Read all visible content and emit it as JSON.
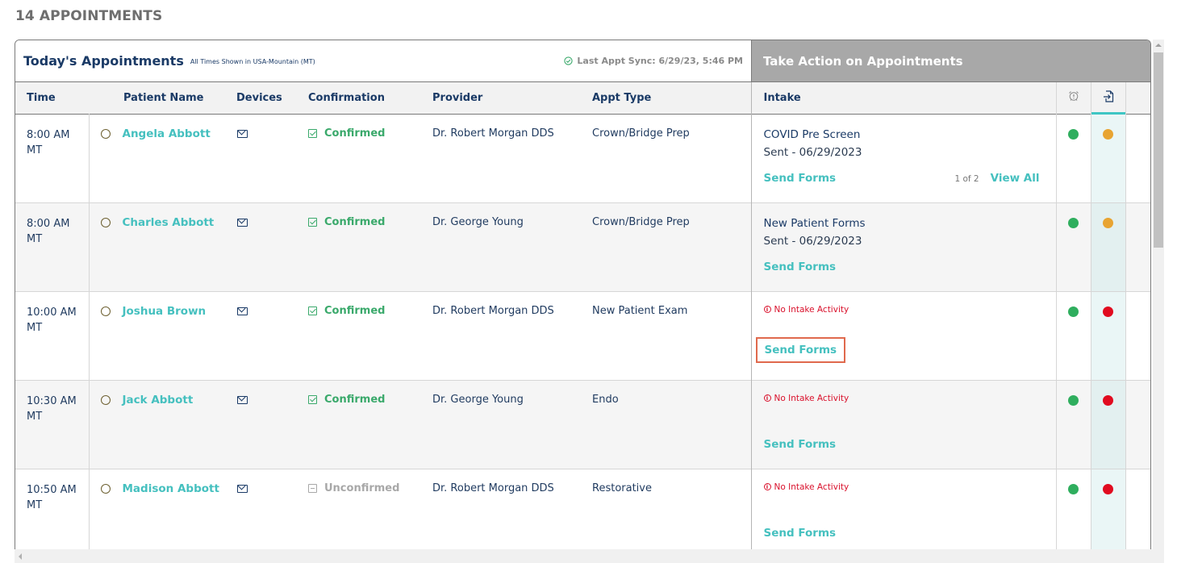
{
  "page": {
    "heading": "14 APPOINTMENTS"
  },
  "panel": {
    "title": "Today's Appointments",
    "timezone_note": "All Times Shown in USA-Mountain (MT)",
    "sync_text": "Last Appt Sync: 6/29/23, 5:46 PM",
    "action_title": "Take Action on Appointments"
  },
  "columns": {
    "time": "Time",
    "patient_name": "Patient Name",
    "devices": "Devices",
    "confirmation": "Confirmation",
    "provider": "Provider",
    "appt_type": "Appt Type",
    "intake": "Intake",
    "reminder_icon": "alarm-clock-icon",
    "forms_icon": "form-import-icon"
  },
  "actions": {
    "send_forms": "Send Forms",
    "view_all": "View All"
  },
  "colors": {
    "accent_teal": "#45c0bf",
    "confirmed_green": "#3aa96b",
    "status_green": "#2fae5e",
    "status_orange": "#e8a432",
    "status_red": "#e10b1f",
    "header_gray": "#a8a8a8"
  },
  "rows": [
    {
      "time": "8:00 AM",
      "tz": "MT",
      "patient": "Angela Abbott",
      "device": "email",
      "confirmation": "Confirmed",
      "provider": "Dr. Robert Morgan DDS",
      "appt_type": "Crown/Bridge Prep",
      "intake_title": "COVID Pre Screen",
      "intake_sent": "Sent - 06/29/2023",
      "pager": "1 of 2",
      "reminder_status": "green",
      "forms_status": "orange"
    },
    {
      "time": "8:00 AM",
      "tz": "MT",
      "patient": "Charles Abbott",
      "device": "email",
      "confirmation": "Confirmed",
      "provider": "Dr. George Young",
      "appt_type": "Crown/Bridge Prep",
      "intake_title": "New Patient Forms",
      "intake_sent": "Sent - 06/29/2023",
      "reminder_status": "green",
      "forms_status": "orange"
    },
    {
      "time": "10:00 AM",
      "tz": "MT",
      "patient": "Joshua Brown",
      "device": "email",
      "confirmation": "Confirmed",
      "provider": "Dr. Robert Morgan DDS",
      "appt_type": "New Patient Exam",
      "intake_alert": "No Intake Activity",
      "reminder_status": "green",
      "forms_status": "red",
      "highlighted": true
    },
    {
      "time": "10:30 AM",
      "tz": "MT",
      "patient": "Jack Abbott",
      "device": "email",
      "confirmation": "Confirmed",
      "provider": "Dr. George Young",
      "appt_type": "Endo",
      "intake_alert": "No Intake Activity",
      "reminder_status": "green",
      "forms_status": "red"
    },
    {
      "time": "10:50 AM",
      "tz": "MT",
      "patient": "Madison Abbott",
      "device": "email",
      "confirmation": "Unconfirmed",
      "provider": "Dr. Robert Morgan DDS",
      "appt_type": "Restorative",
      "intake_alert": "No Intake Activity",
      "reminder_status": "green",
      "forms_status": "red"
    }
  ]
}
